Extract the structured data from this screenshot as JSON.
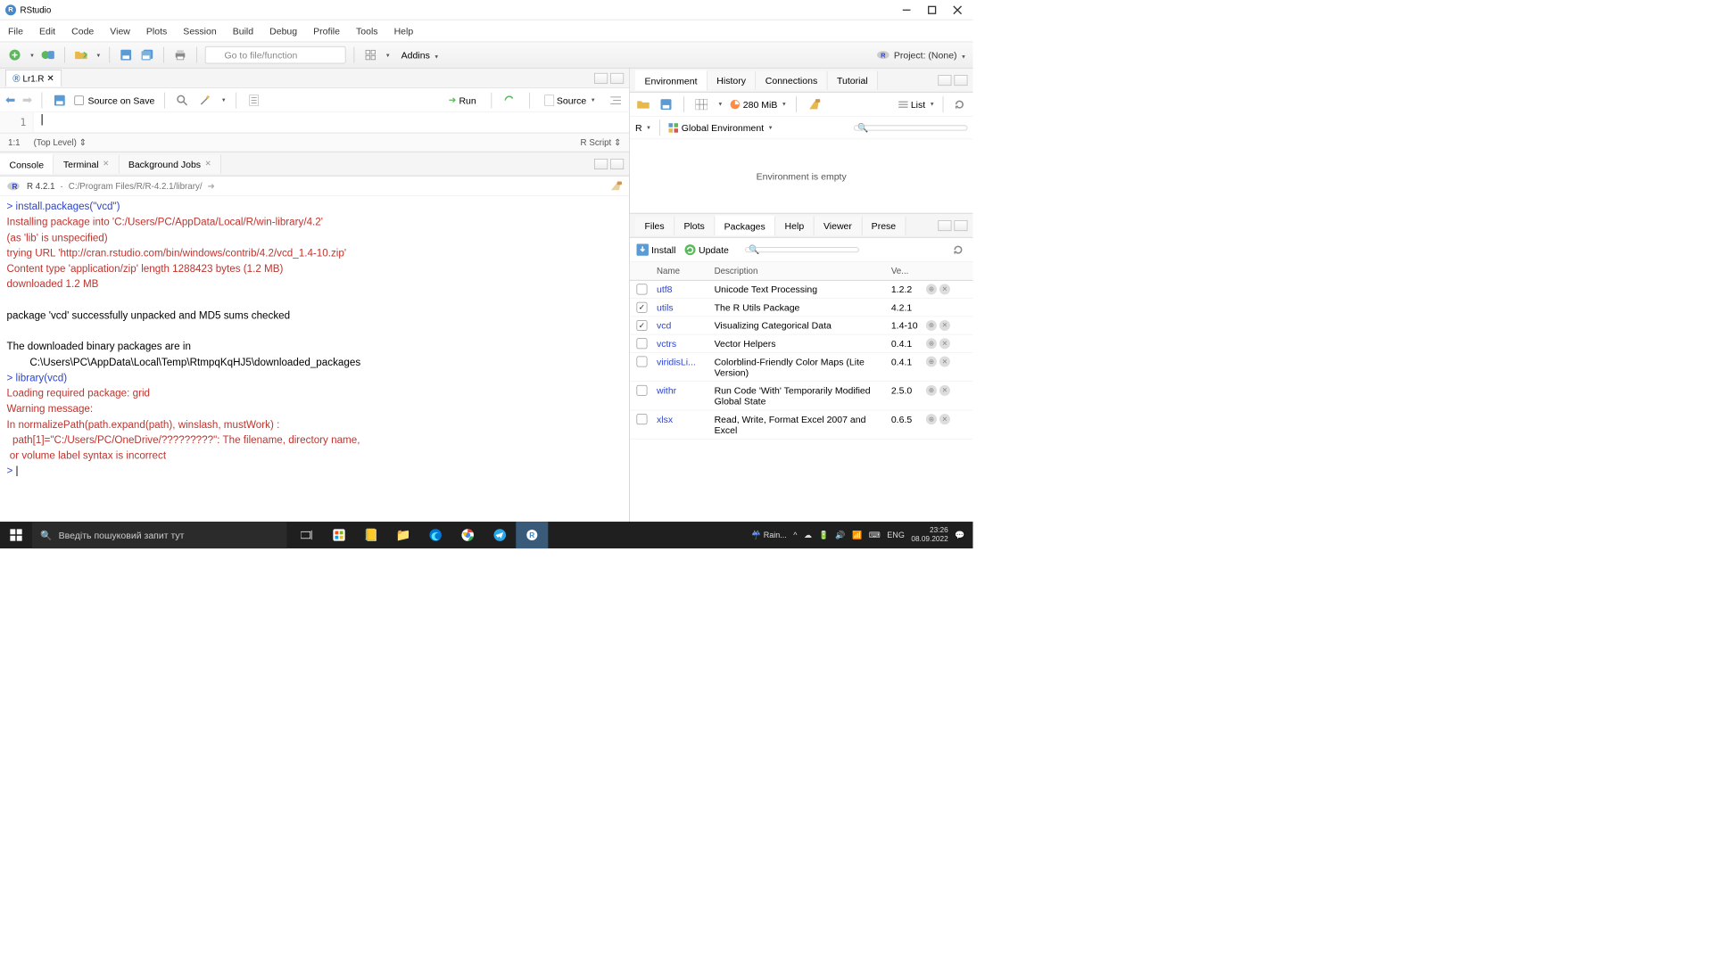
{
  "titlebar": {
    "title": "RStudio"
  },
  "menubar": [
    "File",
    "Edit",
    "Code",
    "View",
    "Plots",
    "Session",
    "Build",
    "Debug",
    "Profile",
    "Tools",
    "Help"
  ],
  "toolbar": {
    "goto_placeholder": "Go to file/function",
    "addins": "Addins",
    "project": "Project: (None)"
  },
  "source": {
    "file_tab": "Lr1.R",
    "source_on_save": "Source on Save",
    "run": "Run",
    "source_btn": "Source",
    "line1": "1",
    "cursor": "1:1",
    "scope": "(Top Level)",
    "lang": "R Script"
  },
  "console_tabs": {
    "console": "Console",
    "terminal": "Terminal",
    "bg": "Background Jobs"
  },
  "console_info": {
    "version": "R 4.2.1",
    "path": "C:/Program Files/R/R-4.2.1/library/"
  },
  "console_lines": [
    {
      "cls": "c-prompt",
      "pre": "> ",
      "txt": "install.packages(\"vcd\")",
      "cmd": true
    },
    {
      "cls": "c-red",
      "txt": "Installing package into 'C:/Users/PC/AppData/Local/R/win-library/4.2'"
    },
    {
      "cls": "c-red",
      "txt": "(as 'lib' is unspecified)"
    },
    {
      "cls": "c-red",
      "txt": "trying URL 'http://cran.rstudio.com/bin/windows/contrib/4.2/vcd_1.4-10.zip'"
    },
    {
      "cls": "c-red",
      "txt": "Content type 'application/zip' length 1288423 bytes (1.2 MB)"
    },
    {
      "cls": "c-red",
      "txt": "downloaded 1.2 MB"
    },
    {
      "cls": "c-black",
      "txt": ""
    },
    {
      "cls": "c-black",
      "txt": "package 'vcd' successfully unpacked and MD5 sums checked"
    },
    {
      "cls": "c-black",
      "txt": ""
    },
    {
      "cls": "c-black",
      "txt": "The downloaded binary packages are in"
    },
    {
      "cls": "c-black",
      "txt": "        C:\\Users\\PC\\AppData\\Local\\Temp\\RtmpqKqHJ5\\downloaded_packages"
    },
    {
      "cls": "c-prompt",
      "pre": "> ",
      "txt": "library(vcd)",
      "cmd": true
    },
    {
      "cls": "c-red",
      "txt": "Loading required package: grid"
    },
    {
      "cls": "c-red",
      "txt": "Warning message:"
    },
    {
      "cls": "c-red",
      "txt": "In normalizePath(path.expand(path), winslash, mustWork) :"
    },
    {
      "cls": "c-red",
      "txt": "  path[1]=\"C:/Users/PC/OneDrive/?????????\": The filename, directory name,"
    },
    {
      "cls": "c-red",
      "txt": " or volume label syntax is incorrect"
    },
    {
      "cls": "c-prompt",
      "pre": "> ",
      "txt": "|",
      "cmd": false
    }
  ],
  "env_tabs": [
    "Environment",
    "History",
    "Connections",
    "Tutorial"
  ],
  "env": {
    "mem": "280 MiB",
    "list": "List",
    "scope": "R",
    "global": "Global Environment",
    "empty": "Environment is empty"
  },
  "pkg_tabs": [
    "Files",
    "Plots",
    "Packages",
    "Help",
    "Viewer",
    "Prese"
  ],
  "pkg": {
    "install": "Install",
    "update": "Update",
    "headers": {
      "name": "Name",
      "desc": "Description",
      "ver": "Ve..."
    },
    "rows": [
      {
        "chk": false,
        "name": "utf8",
        "desc": "Unicode Text Processing",
        "ver": "1.2.2",
        "icons": true
      },
      {
        "chk": true,
        "name": "utils",
        "desc": "The R Utils Package",
        "ver": "4.2.1",
        "icons": false
      },
      {
        "chk": true,
        "name": "vcd",
        "desc": "Visualizing Categorical Data",
        "ver": "1.4-10",
        "icons": true
      },
      {
        "chk": false,
        "name": "vctrs",
        "desc": "Vector Helpers",
        "ver": "0.4.1",
        "icons": true
      },
      {
        "chk": false,
        "name": "viridisLi...",
        "desc": "Colorblind-Friendly Color Maps (Lite Version)",
        "ver": "0.4.1",
        "icons": true
      },
      {
        "chk": false,
        "name": "withr",
        "desc": "Run Code 'With' Temporarily Modified Global State",
        "ver": "2.5.0",
        "icons": true
      },
      {
        "chk": false,
        "name": "xlsx",
        "desc": "Read, Write, Format Excel 2007 and Excel",
        "ver": "0.6.5",
        "icons": true
      }
    ]
  },
  "taskbar": {
    "search_placeholder": "Введіть пошуковий запит тут",
    "weather": "Rain...",
    "lang": "ENG",
    "time": "23:26",
    "date": "08.09.2022"
  }
}
